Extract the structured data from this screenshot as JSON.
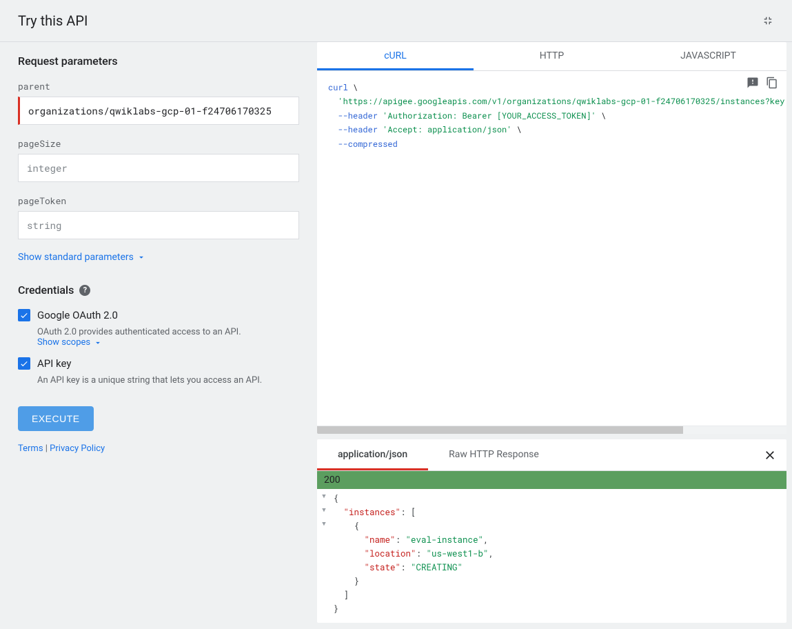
{
  "header": {
    "title": "Try this API"
  },
  "params": {
    "section_title": "Request parameters",
    "parent": {
      "label": "parent",
      "value": "organizations/qwiklabs-gcp-01-f24706170325"
    },
    "pageSize": {
      "label": "pageSize",
      "placeholder": "integer"
    },
    "pageToken": {
      "label": "pageToken",
      "placeholder": "string"
    },
    "show_std": "Show standard parameters"
  },
  "creds": {
    "title": "Credentials",
    "oauth": {
      "label": "Google OAuth 2.0",
      "desc": "OAuth 2.0 provides authenticated access to an API. ",
      "scopes": "Show scopes"
    },
    "apikey": {
      "label": "API key",
      "desc": "An API key is a unique string that lets you access an API."
    }
  },
  "execute": "EXECUTE",
  "footer": {
    "terms": "Terms",
    "privacy": "Privacy Policy",
    "sep": " | "
  },
  "code": {
    "tabs": {
      "curl": "cURL",
      "http": "HTTP",
      "js": "JAVASCRIPT"
    },
    "curl_kw": "curl",
    "line1_url": "'https://apigee.googleapis.com/v1/organizations/qwiklabs-gcp-01-f24706170325/instances?key",
    "line2_flag": "--header",
    "line2_val": "'Authorization: Bearer [YOUR_ACCESS_TOKEN]'",
    "line3_flag": "--header",
    "line3_val": "'Accept: application/json'",
    "line4_flag": "--compressed"
  },
  "response": {
    "tabs": {
      "json": "application/json",
      "raw": "Raw HTTP Response"
    },
    "status": "200",
    "json": {
      "k_instances": "\"instances\"",
      "k_name": "\"name\"",
      "v_name": "\"eval-instance\"",
      "k_location": "\"location\"",
      "v_location": "\"us-west1-b\"",
      "k_state": "\"state\"",
      "v_state": "\"CREATING\""
    }
  }
}
